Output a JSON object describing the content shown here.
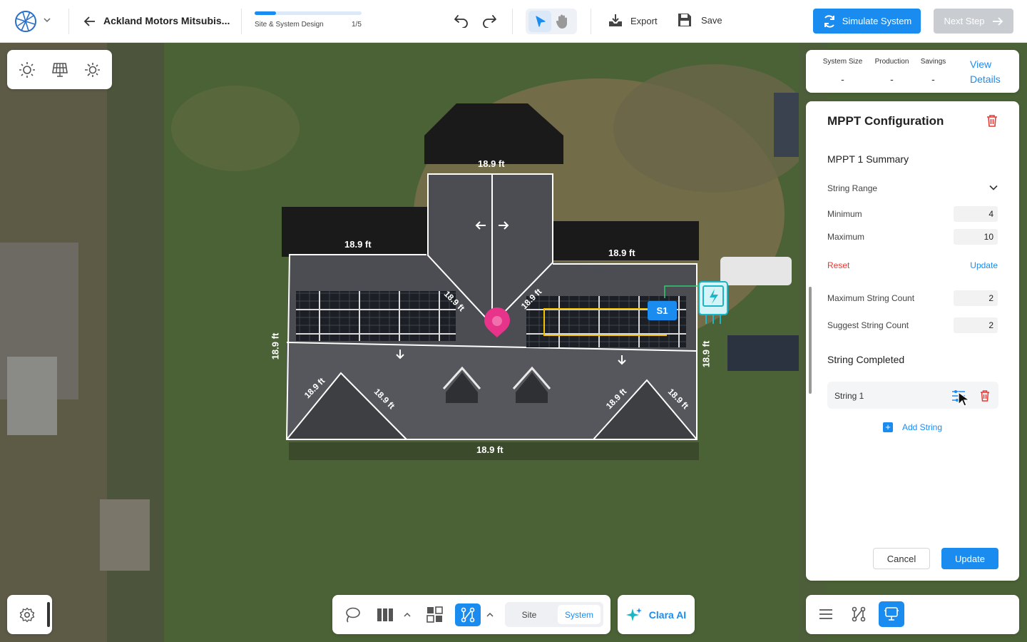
{
  "app": {
    "project_title": "Ackland Motors Mitsubis...",
    "progress": {
      "label": "Site & System Design",
      "step": "1/5",
      "fraction": 0.2
    },
    "export_label": "Export",
    "save_label": "Save",
    "simulate_label": "Simulate System",
    "next_label": "Next Step"
  },
  "summary": {
    "metrics": [
      {
        "label": "System Size",
        "value": "-"
      },
      {
        "label": "Production",
        "value": "-"
      },
      {
        "label": "Savings",
        "value": "-"
      }
    ],
    "view_details_line1": "View",
    "view_details_line2": "Details"
  },
  "mppt": {
    "title": "MPPT Configuration",
    "summary_title": "MPPT 1 Summary",
    "string_range_label": "String Range",
    "minimum_label": "Minimum",
    "minimum_value": "4",
    "maximum_label": "Maximum",
    "maximum_value": "10",
    "reset_label": "Reset",
    "update_link": "Update",
    "max_string_count_label": "Maximum String Count",
    "max_string_count_value": "2",
    "suggest_string_count_label": "Suggest String Count",
    "suggest_string_count_value": "2",
    "string_completed_title": "String Completed",
    "strings": [
      {
        "name": "String 1"
      }
    ],
    "add_string_label": "Add String",
    "cancel_label": "Cancel",
    "update_label": "Update"
  },
  "map": {
    "dimensions": {
      "top_wing": "18.9 ft",
      "left_upper": "18.9 ft",
      "right_upper": "18.9 ft",
      "left_side": "18.9 ft",
      "right_side": "18.9 ft",
      "bottom": "18.9 ft",
      "diag_left_a": "18.9 ft",
      "diag_left_b": "18.9 ft",
      "diag_right_a": "18.9 ft",
      "diag_right_b": "18.9 ft",
      "valley_left": "18.9 ft",
      "valley_right": "18.9 ft"
    },
    "string_marker": "S1"
  },
  "bottom_toolbar": {
    "site_label": "Site",
    "system_label": "System",
    "clara_label": "Clara AI"
  },
  "colors": {
    "accent": "#1a8cf0",
    "danger": "#e53935",
    "pin": "#e8338a",
    "inverter": "#1bb5c8",
    "string_line": "#f2c200"
  }
}
